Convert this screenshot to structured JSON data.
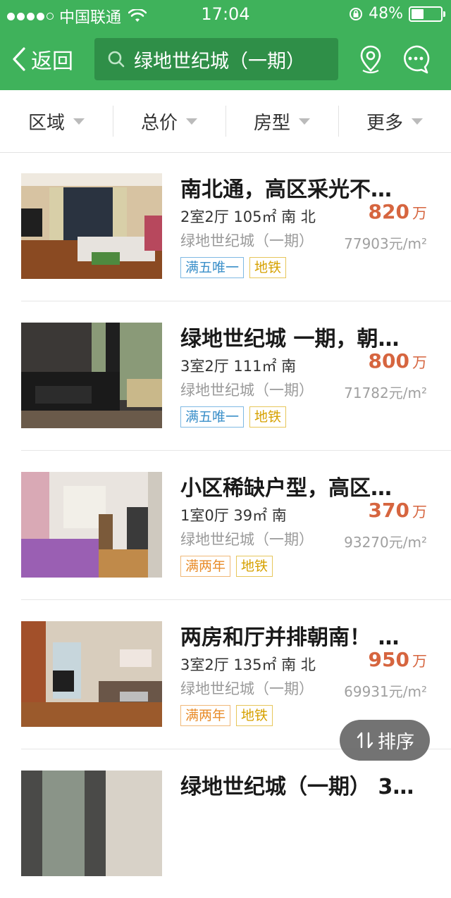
{
  "status": {
    "carrier": "中国联通",
    "time": "17:04",
    "battery_pct": "48%",
    "battery_level": 0.48
  },
  "nav": {
    "back_label": "返回",
    "search_text": "绿地世纪城（一期）",
    "accent": "#3fb25b"
  },
  "filters": [
    "区域",
    "总价",
    "房型",
    "更多"
  ],
  "listings": [
    {
      "title": "南北通，高区采光不…",
      "spec": "2室2厅 105㎡  南 北",
      "community": "绿地世纪城（一期）",
      "price": "820",
      "price_unit": "万",
      "unit_price": "77903元/m²",
      "tags": [
        {
          "text": "满五唯一",
          "style": "blue"
        },
        {
          "text": "地铁",
          "style": "gold"
        }
      ]
    },
    {
      "title": "绿地世纪城 一期，朝…",
      "spec": "3室2厅 111㎡  南",
      "community": "绿地世纪城（一期）",
      "price": "800",
      "price_unit": "万",
      "unit_price": "71782元/m²",
      "tags": [
        {
          "text": "满五唯一",
          "style": "blue"
        },
        {
          "text": "地铁",
          "style": "gold"
        }
      ]
    },
    {
      "title": "小区稀缺户型，高区…",
      "spec": "1室0厅 39㎡  南",
      "community": "绿地世纪城（一期）",
      "price": "370",
      "price_unit": "万",
      "unit_price": "93270元/m²",
      "tags": [
        {
          "text": "满两年",
          "style": "orange"
        },
        {
          "text": "地铁",
          "style": "gold"
        }
      ]
    },
    {
      "title": "两房和厅并排朝南！ …",
      "spec": "3室2厅 135㎡  南 北",
      "community": "绿地世纪城（一期）",
      "price": "950",
      "price_unit": "万",
      "unit_price": "69931元/m²",
      "tags": [
        {
          "text": "满两年",
          "style": "orange"
        },
        {
          "text": "地铁",
          "style": "gold"
        }
      ]
    },
    {
      "title": "绿地世纪城（一期） 3…",
      "spec": "",
      "community": "",
      "price": "",
      "price_unit": "",
      "unit_price": "",
      "tags": []
    }
  ],
  "sort_label": "排序"
}
